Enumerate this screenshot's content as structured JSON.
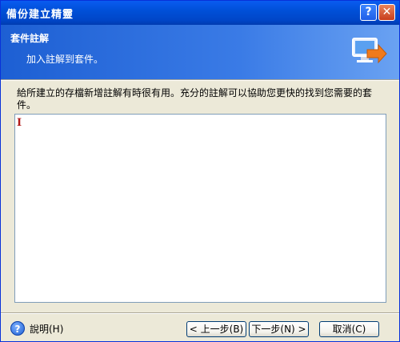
{
  "window": {
    "title": "備份建立精靈"
  },
  "titlebar": {
    "help_glyph": "?",
    "close_glyph": "✕"
  },
  "header": {
    "title": "套件註解",
    "subtitle": "加入註解到套件。"
  },
  "content": {
    "description": "給所建立的存檔新增註解有時很有用。充分的註解可以協助您更快的找到您需要的套件。",
    "notes_value": "",
    "caret_glyph": "I"
  },
  "footer": {
    "help_glyph": "?",
    "help_label": "說明(H)",
    "back_label": "< 上一步(B)",
    "next_label": "下一步(N) >",
    "cancel_label": "取消(C)"
  },
  "colors": {
    "titlebar": "#0050d8",
    "header": "#3a7be6",
    "window_bg": "#ece9d8",
    "close_button": "#c83d1c"
  },
  "icons": [
    "monitor-arrow-icon",
    "help-icon",
    "close-icon"
  ]
}
